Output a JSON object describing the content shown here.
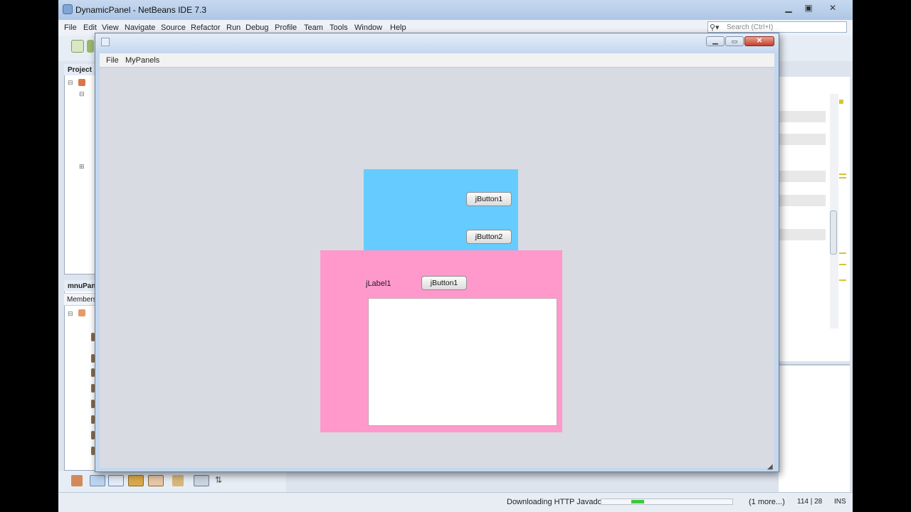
{
  "ide": {
    "title": "DynamicPanel - NetBeans IDE 7.3",
    "menus": [
      "File",
      "Edit",
      "View",
      "Navigate",
      "Source",
      "Refactor",
      "Run",
      "Debug",
      "Profile",
      "Team",
      "Tools",
      "Window",
      "Help"
    ],
    "search_placeholder": "Search (Ctrl+I)",
    "projects_tab": "Project",
    "navigator_tab": "mnuPan",
    "members_label": "Members",
    "status": {
      "message": "Downloading HTTP Javadoc",
      "progress_fraction": 0.1,
      "more": "(1 more...)",
      "position": "114 | 28",
      "mode": "INS"
    }
  },
  "app": {
    "title": "",
    "menus": [
      "File",
      "MyPanels"
    ],
    "blue_panel": {
      "color": "#66ccff",
      "button1": "jButton1",
      "button2": "jButton2"
    },
    "pink_panel": {
      "color": "#ff99cc",
      "label": "jLabel1",
      "button1": "jButton1"
    }
  },
  "icons": [
    "search-icon",
    "minimize-icon",
    "maximize-icon",
    "close-icon",
    "app-icon"
  ]
}
